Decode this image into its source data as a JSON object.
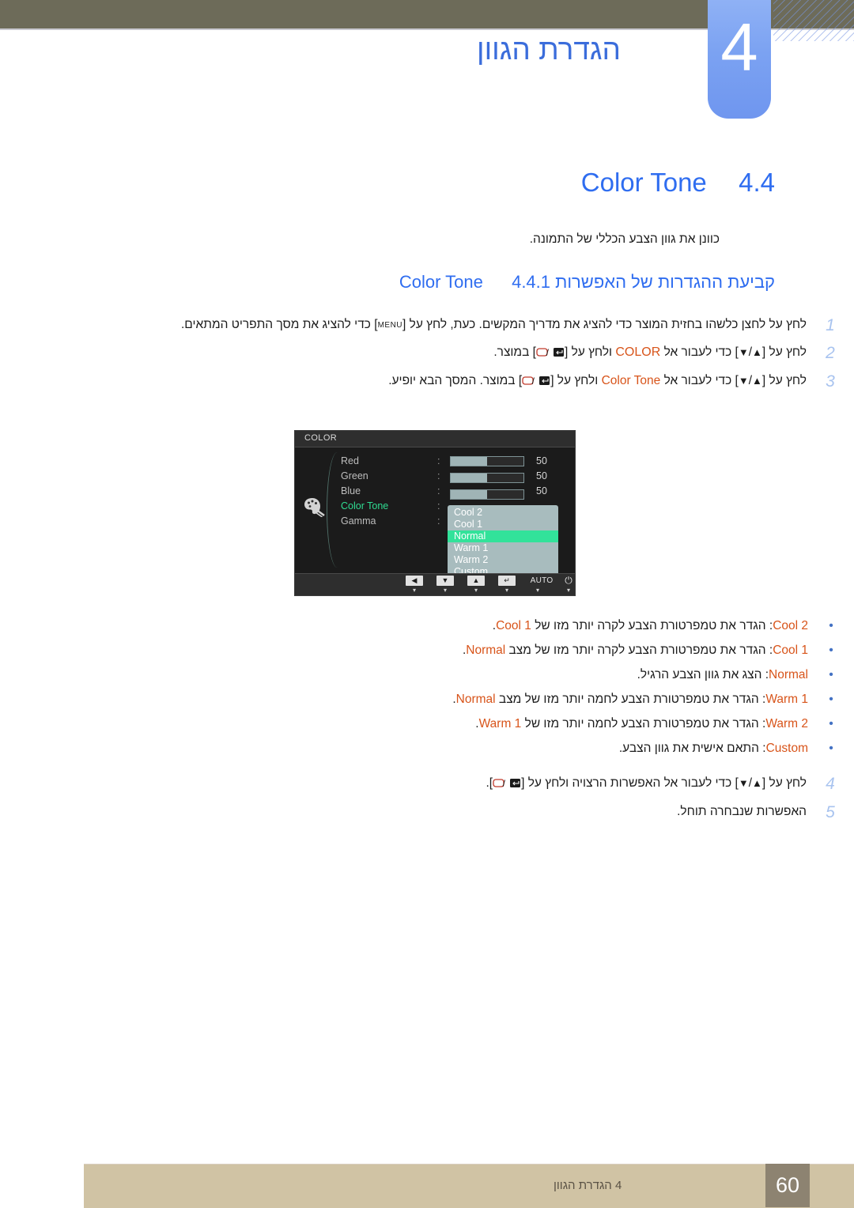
{
  "header": {
    "chapter_number": "4",
    "chapter_title": "הגדרת הגוון"
  },
  "section": {
    "number": "4.4",
    "title": "Color Tone",
    "intro": "כוונן את גוון הצבע הכללי של התמונה.",
    "subsection_number": "4.4.1",
    "subsection_title": "קביעת ההגדרות של האפשרות Color Tone"
  },
  "steps": [
    {
      "num": "1",
      "pre": "לחץ על לחצן כלשהו בחזית המוצר כדי להציג את מדריך המקשים. כעת, לחץ על [",
      "key": "MENU",
      "post": "] כדי להציג את מסך התפריט המתאים."
    },
    {
      "num": "2",
      "t1": "לחץ על [",
      "a1": "▲",
      "a2": "▼",
      "t2": "] כדי לעבור אל ",
      "highlight": "COLOR",
      "t3": " ולחץ על [",
      "t4": "] במוצר."
    },
    {
      "num": "3",
      "t1": "לחץ על [",
      "a1": "▲",
      "a2": "▼",
      "t2": "] כדי לעבור אל ",
      "highlight": "Color Tone",
      "t3": " ולחץ על [",
      "t4": "] במוצר. המסך הבא יופיע."
    },
    {
      "num": "4",
      "t1": "לחץ על [",
      "a1": "▲",
      "a2": "▼",
      "t2": "] כדי לעבור אל האפשרות הרצויה ולחץ על [",
      "t4": "]."
    },
    {
      "num": "5",
      "t1": "האפשרות שנבחרה תוחל."
    }
  ],
  "osd": {
    "title": "COLOR",
    "menu_icon": "palette-icon",
    "rows": [
      {
        "label": "Red",
        "colon": ":",
        "value": "50",
        "slider_pct": 50,
        "selected": false
      },
      {
        "label": "Green",
        "colon": ":",
        "value": "50",
        "slider_pct": 50,
        "selected": false
      },
      {
        "label": "Blue",
        "colon": ":",
        "value": "50",
        "slider_pct": 50,
        "selected": false
      },
      {
        "label": "Color Tone",
        "colon": ":",
        "value": "",
        "slider_pct": 0,
        "selected": true
      },
      {
        "label": "Gamma",
        "colon": ":",
        "value": "",
        "slider_pct": 0,
        "selected": false
      }
    ],
    "dropdown": [
      {
        "label": "Cool 2",
        "highlighted": false
      },
      {
        "label": "Cool 1",
        "highlighted": false
      },
      {
        "label": "Normal",
        "highlighted": true
      },
      {
        "label": "Warm 1",
        "highlighted": false
      },
      {
        "label": "Warm 2",
        "highlighted": false
      },
      {
        "label": "Custom",
        "highlighted": false
      }
    ],
    "buttons": [
      {
        "glyph": "◀",
        "icon": "left-arrow-icon",
        "kind": "cap"
      },
      {
        "glyph": "▼",
        "icon": "down-arrow-icon",
        "kind": "cap"
      },
      {
        "glyph": "▲",
        "icon": "up-arrow-icon",
        "kind": "cap"
      },
      {
        "glyph": "↵",
        "icon": "enter-icon",
        "kind": "cap"
      },
      {
        "glyph": "AUTO",
        "icon": "auto-label",
        "kind": "txt"
      },
      {
        "glyph": "⏻",
        "icon": "power-icon",
        "kind": "pw"
      }
    ],
    "tick": "▾",
    "highlight_color": "#32e29a",
    "selected_label_color": "#2fdc92"
  },
  "options": [
    {
      "dot": "•",
      "name": "Cool 2",
      "desc_pre": ": הגדר את טמפרטורת הצבע לקרה יותר מזו של ",
      "ref": "Cool 1",
      "desc_post": "."
    },
    {
      "dot": "•",
      "name": "Cool 1",
      "desc_pre": ": הגדר את טמפרטורת הצבע לקרה יותר מזו של מצב ",
      "ref": "Normal",
      "desc_post": "."
    },
    {
      "dot": "•",
      "name": "Normal",
      "desc_pre": ": הצג את גוון הצבע הרגיל.",
      "ref": "",
      "desc_post": ""
    },
    {
      "dot": "•",
      "name": "Warm 1",
      "desc_pre": ": הגדר את טמפרטורת הצבע לחמה יותר מזו של מצב ",
      "ref": "Normal",
      "desc_post": "."
    },
    {
      "dot": "•",
      "name": "Warm 2",
      "desc_pre": ": הגדר את טמפרטורת הצבע לחמה יותר מזו של ",
      "ref": "Warm 1",
      "desc_post": "."
    },
    {
      "dot": "•",
      "name": "Custom",
      "desc_pre": ": התאם אישית את גוון הצבע.",
      "ref": "",
      "desc_post": ""
    }
  ],
  "footer": {
    "page": "60",
    "text": "4 הגדרת הגוון"
  },
  "colors": {
    "accent_blue": "#2f6df0",
    "orange": "#d8541a",
    "header_olive": "#6d6b59",
    "tab_blue": "#7ba2f2",
    "footer_tan": "#d0c3a4"
  }
}
